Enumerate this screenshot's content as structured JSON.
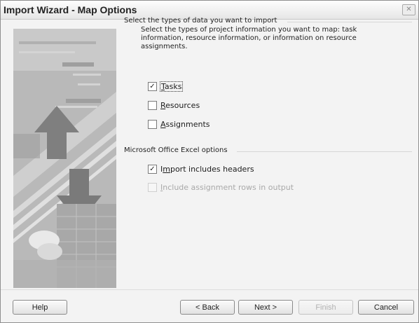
{
  "window": {
    "title": "Import Wizard - Map Options",
    "close_glyph": "✕"
  },
  "data_types": {
    "heading": "Select the types of data you want to import",
    "description": "Select the types of project information you want to map: task information, resource information, or information on resource assignments.",
    "options": [
      {
        "label": "Tasks",
        "accel": "T",
        "rest": "asks",
        "checked": true,
        "enabled": true,
        "focused": true
      },
      {
        "label": "Resources",
        "accel": "R",
        "rest": "esources",
        "checked": false,
        "enabled": true
      },
      {
        "label": "Assignments",
        "accel": "A",
        "rest": "ssignments",
        "checked": false,
        "enabled": true
      }
    ]
  },
  "excel_options": {
    "heading": "Microsoft Office Excel options",
    "options": [
      {
        "label": "Import includes headers",
        "pre": "I",
        "accel": "m",
        "rest": "port includes headers",
        "checked": true,
        "enabled": true
      },
      {
        "label": "Include assignment rows in output",
        "accel": "I",
        "rest": "nclude assignment rows in output",
        "checked": false,
        "enabled": false
      }
    ]
  },
  "buttons": {
    "help": "Help",
    "back": "< Back",
    "next": "Next >",
    "finish": "Finish",
    "cancel": "Cancel",
    "finish_enabled": false
  }
}
